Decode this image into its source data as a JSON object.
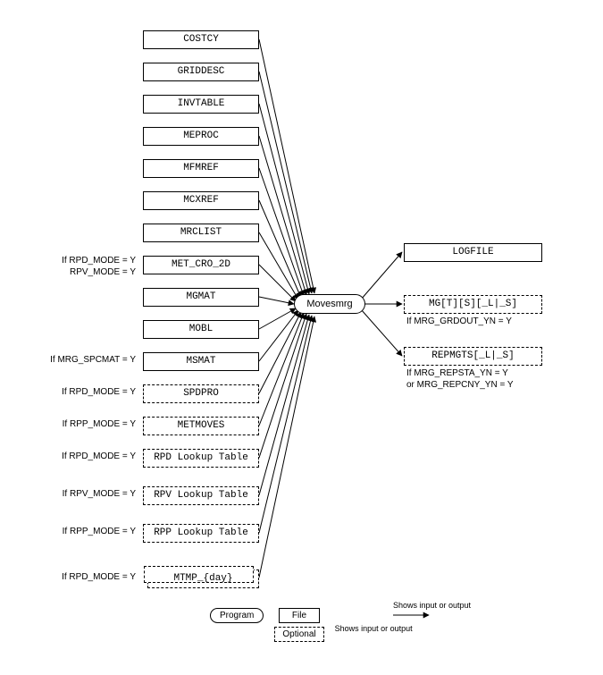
{
  "program": {
    "label": "Movesmrg"
  },
  "inputs": [
    {
      "id": "costcy",
      "label": "COSTCY",
      "optional": false,
      "condition": null
    },
    {
      "id": "griddesc",
      "label": "GRIDDESC",
      "optional": false,
      "condition": null
    },
    {
      "id": "invtable",
      "label": "INVTABLE",
      "optional": false,
      "condition": null
    },
    {
      "id": "meproc",
      "label": "MEPROC",
      "optional": false,
      "condition": null
    },
    {
      "id": "mfmref",
      "label": "MFMREF",
      "optional": false,
      "condition": null
    },
    {
      "id": "mcxref",
      "label": "MCXREF",
      "optional": false,
      "condition": null
    },
    {
      "id": "mrclist",
      "label": "MRCLIST",
      "optional": false,
      "condition": null
    },
    {
      "id": "metcro2d",
      "label": "MET_CRO_2D",
      "optional": false,
      "condition": "If RPD_MODE = Y\nRPV_MODE = Y"
    },
    {
      "id": "mgmat",
      "label": "MGMAT",
      "optional": false,
      "condition": null
    },
    {
      "id": "mobl",
      "label": "MOBL",
      "optional": false,
      "condition": null
    },
    {
      "id": "msmat",
      "label": "MSMAT",
      "optional": false,
      "condition": "If MRG_SPCMAT = Y"
    },
    {
      "id": "spdpro",
      "label": "SPDPRO",
      "optional": true,
      "condition": "If RPD_MODE = Y"
    },
    {
      "id": "metmoves",
      "label": "METMOVES",
      "optional": true,
      "condition": "If RPP_MODE = Y"
    },
    {
      "id": "rpdlut",
      "label": "RPD Lookup Table",
      "optional": true,
      "condition": "If RPD_MODE = Y"
    },
    {
      "id": "rpvlut",
      "label": "RPV Lookup Table",
      "optional": true,
      "condition": "If RPV_MODE = Y"
    },
    {
      "id": "rpplut",
      "label": "RPP Lookup Table",
      "optional": true,
      "condition": "If RPP_MODE = Y"
    },
    {
      "id": "mtmp",
      "label": "MTMP_{day}",
      "optional": true,
      "condition": "If RPD_MODE = Y",
      "stack": true
    }
  ],
  "outputs": [
    {
      "id": "logfile",
      "label": "LOGFILE",
      "optional": false,
      "condition": null
    },
    {
      "id": "mgts",
      "label": "MG[T][S][_L|_S]",
      "optional": true,
      "condition": "If MRG_GRDOUT_YN = Y"
    },
    {
      "id": "repmgts",
      "label": "REPMGTS[_L|_S]",
      "optional": true,
      "condition": "If MRG_REPSTA_YN = Y\nor MRG_REPCNY_YN = Y"
    }
  ],
  "legend": {
    "program": "Program",
    "file": "File",
    "optional": "Optional",
    "arrow": "Shows input or output"
  }
}
